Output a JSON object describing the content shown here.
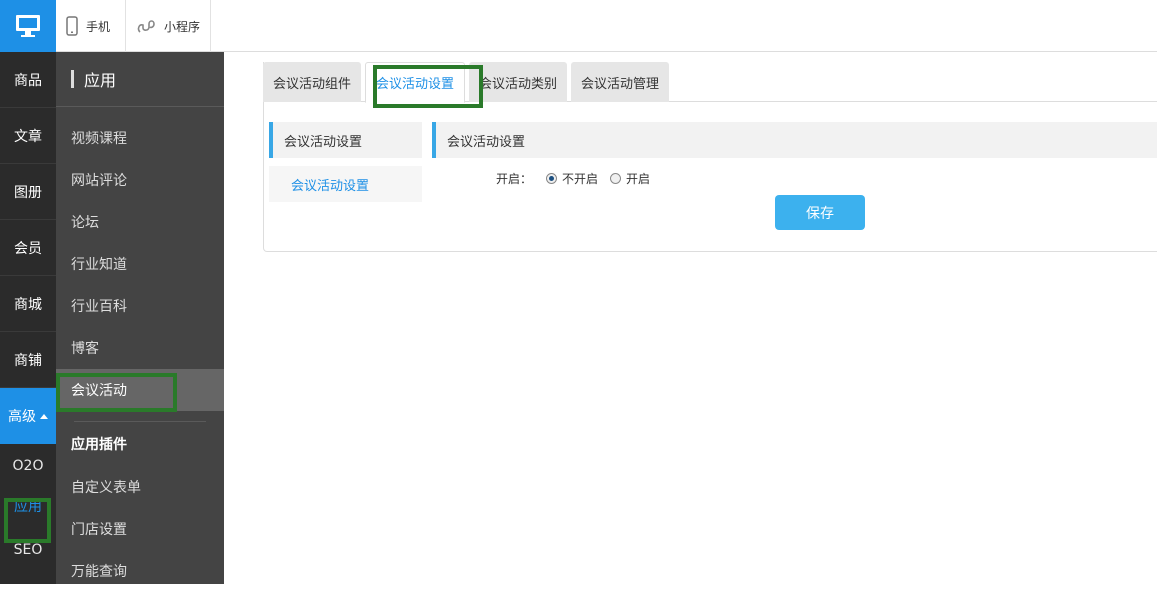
{
  "topbar": {
    "tabs": [
      {
        "label": "手机",
        "icon": "phone-icon"
      },
      {
        "label": "小程序",
        "icon": "mini-program-icon"
      }
    ],
    "logo_icon": "monitor-icon"
  },
  "leftnav": {
    "items": [
      "商品",
      "文章",
      "图册",
      "会员",
      "商城",
      "商铺"
    ],
    "active_item": "高级",
    "sub_items": [
      "O2O",
      "应用",
      "SEO"
    ]
  },
  "subnav": {
    "title": "应用",
    "items": [
      "视频课程",
      "网站评论",
      "论坛",
      "行业知道",
      "行业百科",
      "博客",
      "会议活动"
    ],
    "group_title": "应用插件",
    "group_items": [
      "自定义表单",
      "门店设置",
      "万能查询"
    ]
  },
  "main": {
    "tabs": [
      "会议活动组件",
      "会议活动设置",
      "会议活动类别",
      "会议活动管理"
    ],
    "inner_menu_head": "会议活动设置",
    "inner_menu_item": "会议活动设置",
    "section_title": "会议活动设置",
    "form": {
      "label": "开启：",
      "option_off": "不开启",
      "option_on": "开启"
    },
    "save_label": "保存"
  },
  "colors": {
    "accent": "#1e90e6",
    "highlight": "#2a7a2a",
    "sidebar_dark": "#2b2b2b",
    "sidebar_mid": "#444444"
  }
}
